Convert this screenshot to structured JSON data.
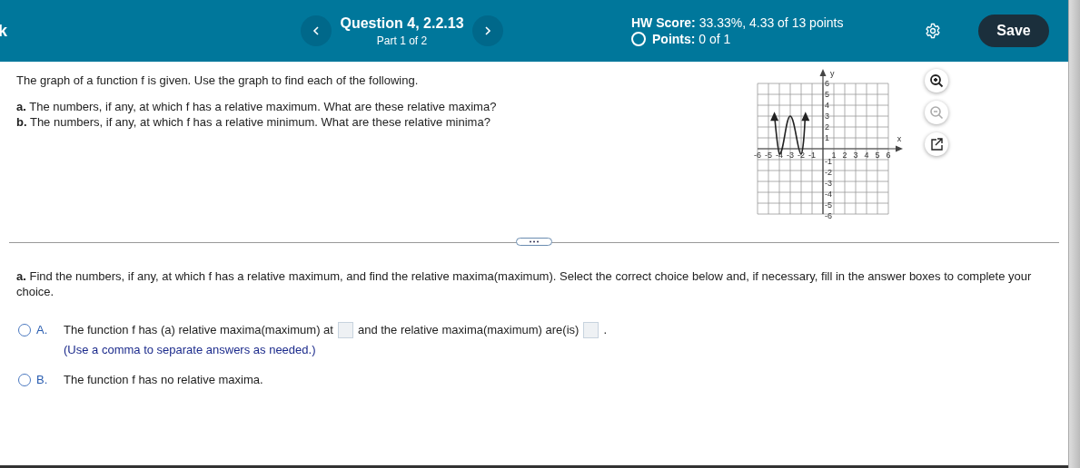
{
  "header": {
    "back_label": "k",
    "question_title": "Question 4, 2.2.13",
    "part": "Part 1 of 2",
    "hw_score_label": "HW Score:",
    "hw_score_value": "33.33%, 4.33 of 13 points",
    "points_label": "Points:",
    "points_value": "0 of 1",
    "save_button": "Save"
  },
  "problem": {
    "intro": "The graph of a function f is given. Use the graph to find each of the following.",
    "parts": [
      "**a.** The numbers, if any, at which f has a relative maximum. What are these relative maxima?",
      "**b.** The numbers, if any, at which f has a relative minimum. What are these relative minima?"
    ]
  },
  "graph": {
    "x_axis_label": "x",
    "y_axis_label": "y",
    "x_tick_labels": [
      "-6",
      "-5",
      "-4",
      "-3",
      "-2",
      "-1",
      "1",
      "2",
      "3",
      "4",
      "5",
      "6"
    ],
    "y_tick_labels": [
      "6",
      "5",
      "4",
      "3",
      "2",
      "1",
      "-1",
      "-2",
      "-3",
      "-4",
      "-5",
      "-6"
    ]
  },
  "graph_tools": [
    {
      "kind": "zoom-in",
      "disabled": false
    },
    {
      "kind": "zoom-out",
      "disabled": true
    },
    {
      "kind": "popout",
      "disabled": false
    }
  ],
  "question": {
    "prompt": "**a.** Find the numbers, if any, at which f has a relative maximum, and find the relative maxima(maximum). Select the correct choice below and, if necessary, fill in the answer boxes to complete your choice.",
    "choices": [
      {
        "letter": "A.",
        "selected": false,
        "parts": [
          {
            "kind": "text",
            "text": "The function f has (a) relative maxima(maximum) at"
          },
          {
            "kind": "answer-box"
          },
          {
            "kind": "text",
            "text": "and the relative maxima(maximum) are(is)"
          },
          {
            "kind": "answer-box"
          },
          {
            "kind": "text",
            "text": "."
          }
        ],
        "hint": "(Use a comma to separate answers as needed.)"
      },
      {
        "letter": "B.",
        "selected": false,
        "parts": [
          {
            "kind": "text",
            "text": "The function f has no relative maxima."
          }
        ]
      }
    ]
  }
}
